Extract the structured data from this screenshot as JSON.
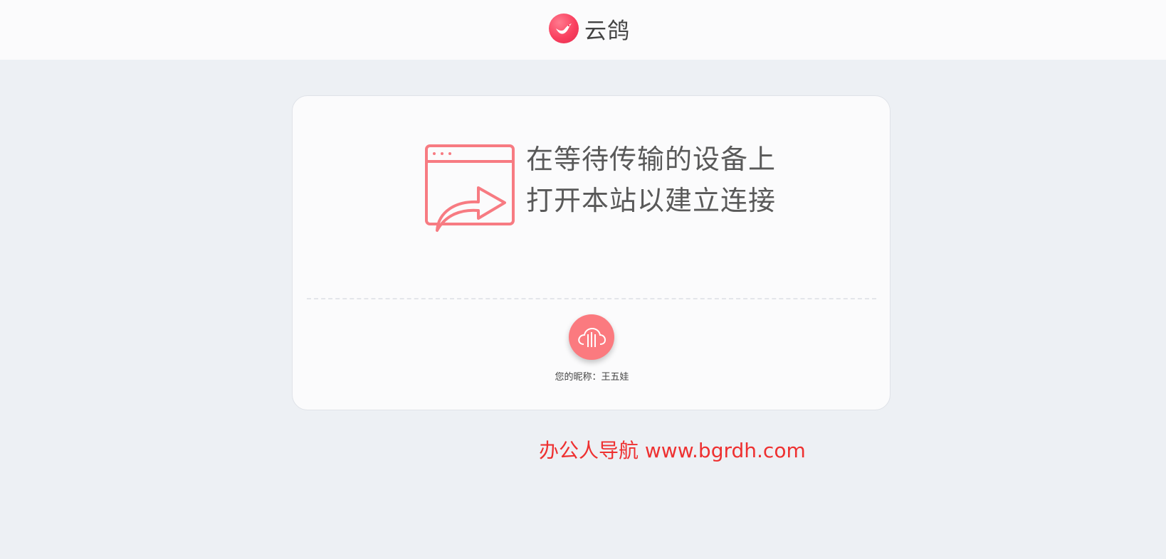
{
  "header": {
    "brand_name": "云鸽",
    "logo_icon": "dove-icon",
    "accent_color": "#f9405f"
  },
  "main": {
    "instruction_line1": "在等待传输的设备上",
    "instruction_line2": "打开本站以建立连接",
    "illustration_icon": "browser-share-icon",
    "device_icon": "cloud-transfer-icon",
    "nickname_label": "您的昵称：",
    "nickname_value": "王五娃",
    "accent_color": "#fb7a7f"
  },
  "watermark": {
    "text": "办公人导航 www.bgrdh.com",
    "color": "#ee3030"
  }
}
